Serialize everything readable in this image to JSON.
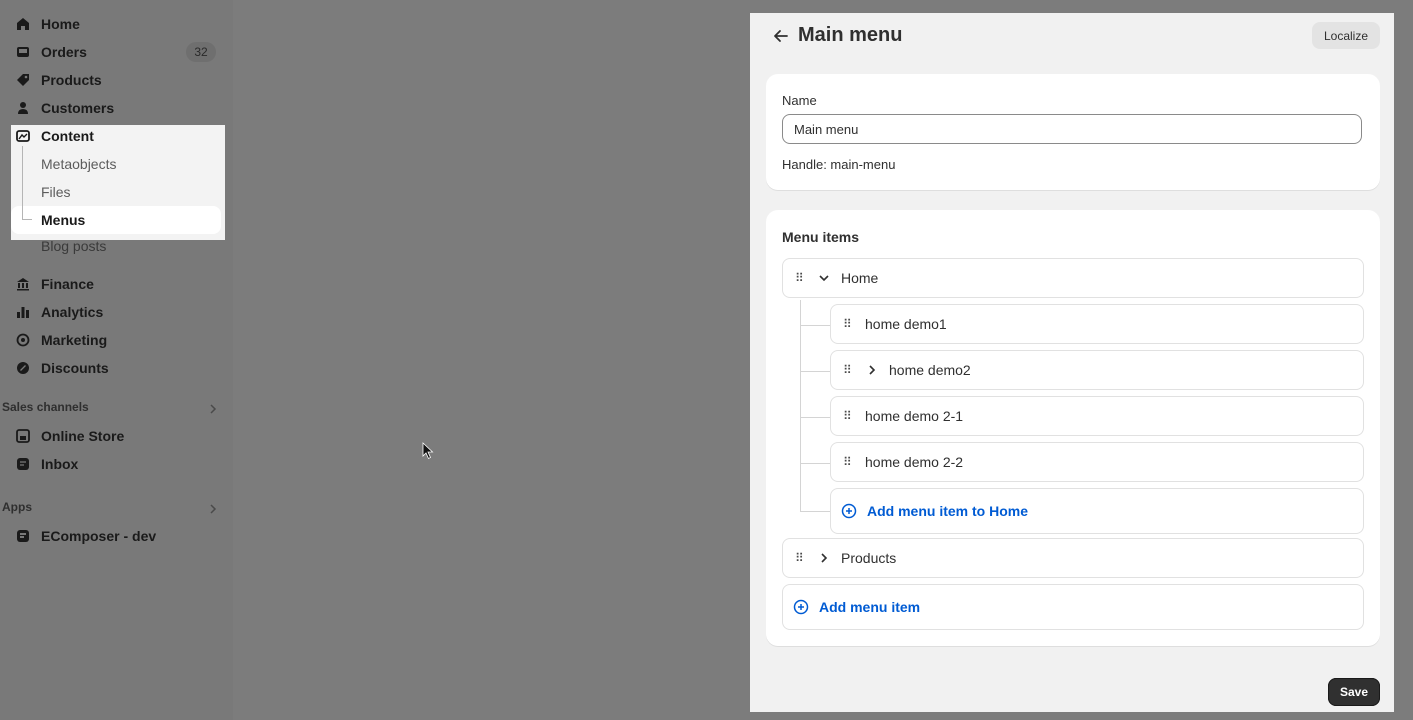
{
  "sidebar": {
    "items": [
      {
        "label": "Home",
        "icon": "home-icon"
      },
      {
        "label": "Orders",
        "icon": "inbox-icon",
        "badge": "32"
      },
      {
        "label": "Products",
        "icon": "tag-icon"
      },
      {
        "label": "Customers",
        "icon": "person-icon"
      },
      {
        "label": "Content",
        "icon": "image-icon"
      }
    ],
    "content_sub": [
      "Metaobjects",
      "Files",
      "Menus",
      "Blog posts"
    ],
    "items2": [
      {
        "label": "Finance",
        "icon": "bank-icon"
      },
      {
        "label": "Analytics",
        "icon": "bar-chart-icon"
      },
      {
        "label": "Marketing",
        "icon": "target-icon"
      },
      {
        "label": "Discounts",
        "icon": "discount-icon"
      }
    ],
    "sales_channels_heading": "Sales channels",
    "sales_channels": [
      {
        "label": "Online Store",
        "icon": "store-icon"
      },
      {
        "label": "Inbox",
        "icon": "chat-icon"
      }
    ],
    "apps_heading": "Apps",
    "apps": [
      {
        "label": "EComposer - dev",
        "icon": "app-icon"
      }
    ]
  },
  "panel": {
    "title": "Main menu",
    "localize_label": "Localize",
    "name_label": "Name",
    "name_value": "Main menu",
    "handle_text": "Handle: main-menu",
    "menu_items_heading": "Menu items",
    "home": "Home",
    "children": [
      "home demo1",
      "home demo2",
      "home demo 2-1",
      "home demo 2-2"
    ],
    "add_to_home": "Add menu item to Home",
    "products": "Products",
    "add_item": "Add menu item",
    "save_label": "Save"
  },
  "colors": {
    "accent": "#005bd3",
    "save_bg": "#303030"
  }
}
